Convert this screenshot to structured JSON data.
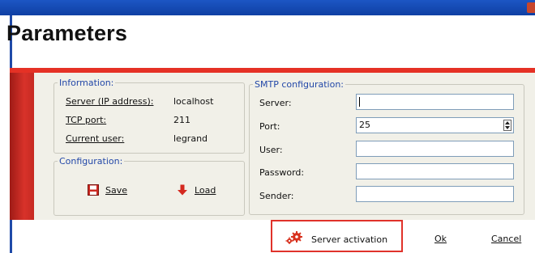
{
  "window": {
    "title": "Parameters"
  },
  "information": {
    "legend": "Information:",
    "server_label": "Server (IP address):",
    "server_value": "localhost",
    "port_label": "TCP port:",
    "port_value": "211",
    "user_label": "Current user:",
    "user_value": "legrand"
  },
  "configuration": {
    "legend": "Configuration:",
    "save_label": "Save",
    "load_label": "Load"
  },
  "smtp": {
    "legend": "SMTP configuration:",
    "server_label": "Server:",
    "server_value": "",
    "port_label": "Port:",
    "port_value": "25",
    "user_label": "User:",
    "user_value": "",
    "password_label": "Password:",
    "password_value": "",
    "sender_label": "Sender:",
    "sender_value": ""
  },
  "footer": {
    "activation_label": "Server activation",
    "ok_label": "Ok",
    "cancel_label": "Cancel"
  },
  "colors": {
    "accent_red": "#e53125",
    "titlebar_blue": "#1c56c4",
    "legend_blue": "#2348a8"
  }
}
